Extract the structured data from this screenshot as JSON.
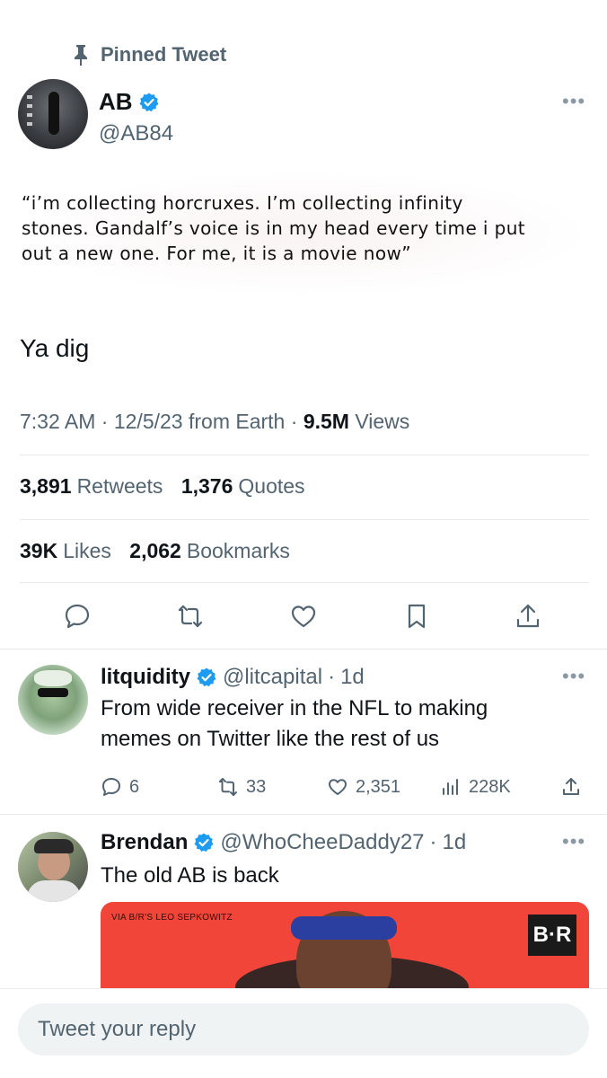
{
  "pinned_label": "Pinned Tweet",
  "tweet": {
    "author_name": "AB",
    "author_handle": "@AB84",
    "quote_lines": [
      "“i’m collecting horcruxes. I’m collecting infinity",
      "stones. Gandalf’s voice is in my head every time i put",
      "out a new one. For me, it is a movie now”"
    ],
    "text": "Ya dig",
    "time": "7:32 AM",
    "date": "12/5/23",
    "source": "from Earth",
    "views_count": "9.5M",
    "views_label": "Views",
    "retweets_count": "3,891",
    "retweets_label": "Retweets",
    "quotes_count": "1,376",
    "quotes_label": "Quotes",
    "likes_count": "39K",
    "likes_label": "Likes",
    "bookmarks_count": "2,062",
    "bookmarks_label": "Bookmarks"
  },
  "replies": [
    {
      "name": "litquidity",
      "handle": "@litcapital",
      "age": "1d",
      "text_lines": [
        "From wide receiver in the NFL to making",
        "memes on Twitter like the rest of us"
      ],
      "replies_count": "6",
      "retweets_count": "33",
      "likes_count": "2,351",
      "views_count": "228K"
    },
    {
      "name": "Brendan",
      "handle": "@WhoCheeDaddy27",
      "age": "1d",
      "text": "The old AB is back",
      "media_via": "VIA B/R'S LEO SEPKOWITZ",
      "media_logo": "B·R"
    }
  ],
  "reply_placeholder": "Tweet your reply",
  "colors": {
    "accent": "#1d9bf0",
    "muted": "#536471",
    "text": "#0f1419",
    "divider": "#e6e9eb"
  },
  "icons": [
    "pin-icon",
    "verified-icon",
    "more-icon",
    "reply-icon",
    "retweet-icon",
    "like-icon",
    "bookmark-icon",
    "share-icon",
    "views-icon"
  ]
}
